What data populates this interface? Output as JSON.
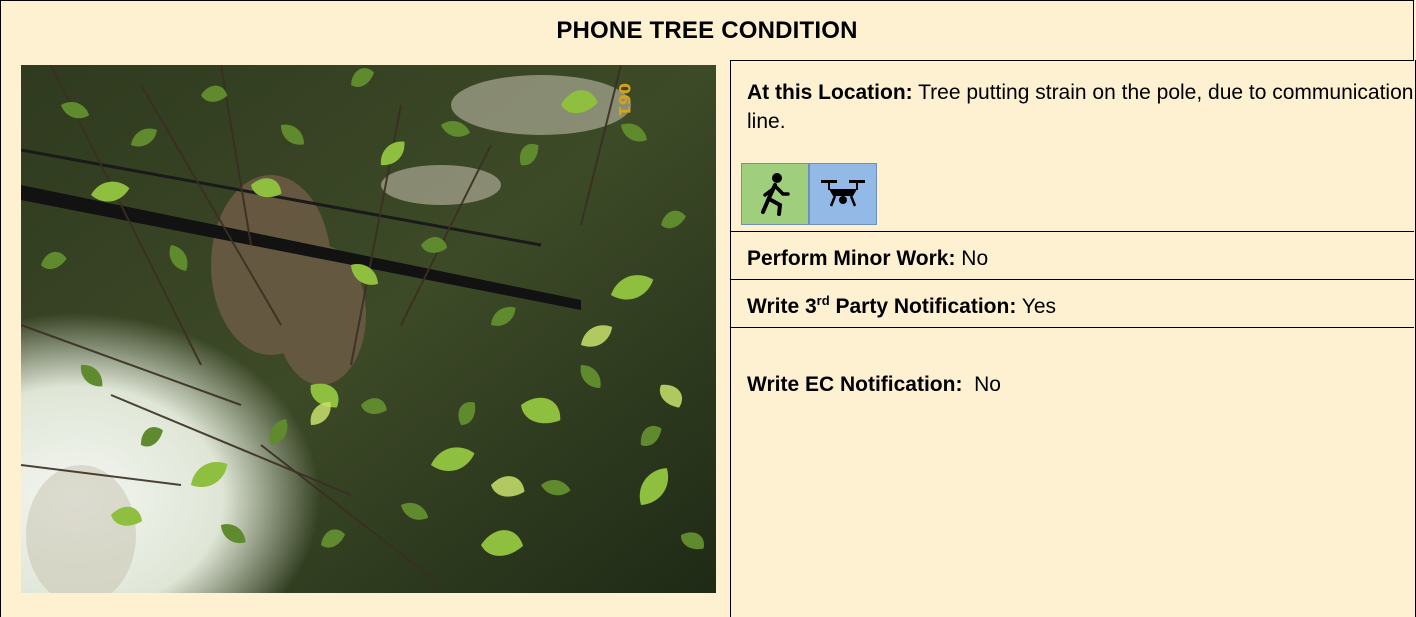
{
  "title": "PHONE TREE CONDITION",
  "location": {
    "label": "At this Location:",
    "text": " Tree putting strain on the pole, due to communication line."
  },
  "icons": [
    {
      "name": "walking-person-icon",
      "bg": "#9fcf7c"
    },
    {
      "name": "drone-icon",
      "bg": "#93b9e6"
    }
  ],
  "minor_work": {
    "label": "Perform Minor Work:",
    "value": " No"
  },
  "third_party": {
    "label_pre": "Write 3",
    "label_sup": "rd",
    "label_post": " Party Notification:",
    "value": " Yes"
  },
  "ec": {
    "label": "Write EC Notification:",
    "value": "  No"
  },
  "photo": {
    "stamp": "061"
  },
  "colors": {
    "background": "#fdf1d1",
    "border": "#000000"
  }
}
